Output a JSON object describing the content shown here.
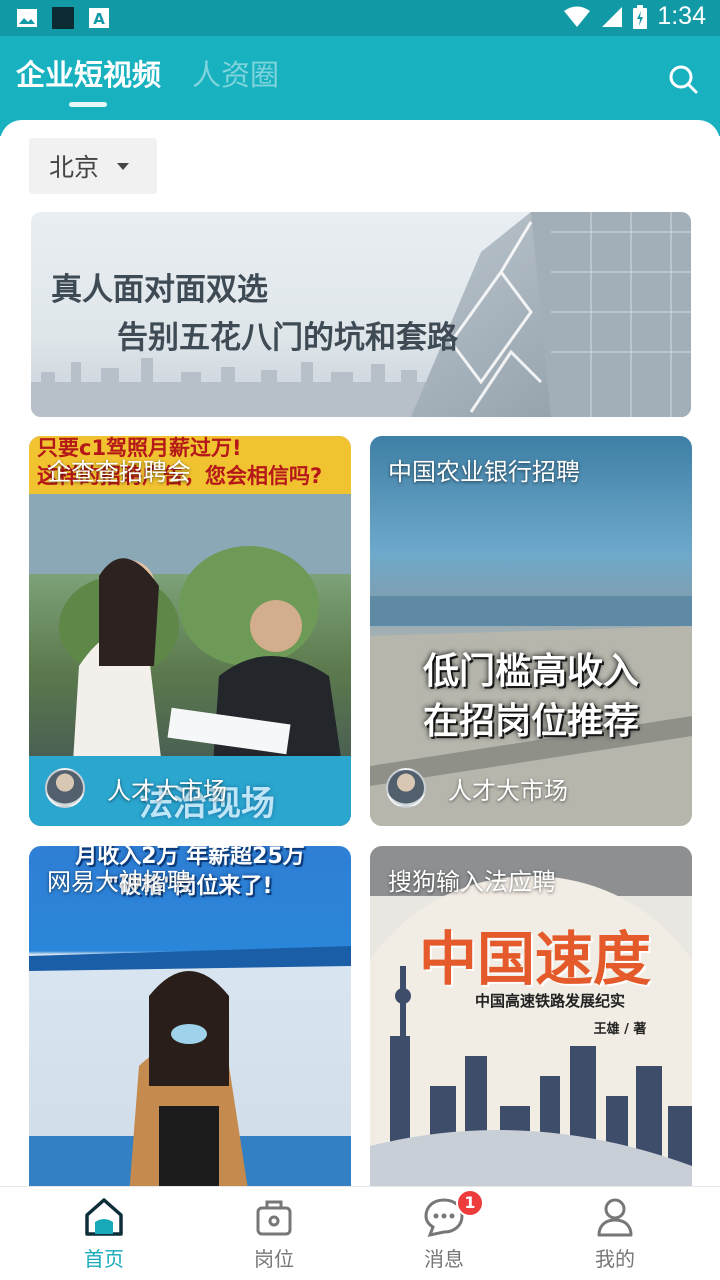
{
  "status_bar": {
    "time": "1:34",
    "icons": [
      "image-icon",
      "square-icon",
      "a-letter-icon",
      "wifi-icon",
      "signal-icon",
      "battery-icon"
    ]
  },
  "header": {
    "tabs": [
      {
        "label": "企业短视频",
        "active": true
      },
      {
        "label": "人资圈",
        "active": false
      }
    ],
    "search_icon": "search-icon"
  },
  "filter": {
    "city": "北京"
  },
  "banner": {
    "line1": "真人面对面双选",
    "line2": "告别五花八门的坑和套路"
  },
  "videos": [
    {
      "title": "企查查招聘会",
      "author": "人才大市场",
      "overlay_top": "只要c1驾照月薪过万!\n这样的招聘广告，您会相信吗?",
      "overlay_bottom": "法治现场"
    },
    {
      "title": "中国农业银行招聘",
      "author": "人才大市场",
      "overlay_line1": "低门槛高收入",
      "overlay_line2": "在招岗位推荐"
    },
    {
      "title": "网易大神招聘",
      "overlay_top": "月收入2万 年薪超25万\n\"破格\"岗位来了!"
    },
    {
      "title": "搜狗输入法应聘",
      "overlay_big": "中国速度",
      "overlay_sub": "中国高速铁路发展纪实",
      "overlay_author": "王雄 / 著"
    }
  ],
  "bottom_nav": [
    {
      "label": "首页",
      "icon": "home-icon",
      "active": true
    },
    {
      "label": "岗位",
      "icon": "briefcase-icon",
      "active": false
    },
    {
      "label": "消息",
      "icon": "chat-icon",
      "active": false,
      "badge": "1"
    },
    {
      "label": "我的",
      "icon": "profile-icon",
      "active": false
    }
  ],
  "colors": {
    "header_bg": "#17b1bf",
    "status_bg": "#119aa6",
    "accent": "#18aab8",
    "badge": "#ee3c3c"
  }
}
